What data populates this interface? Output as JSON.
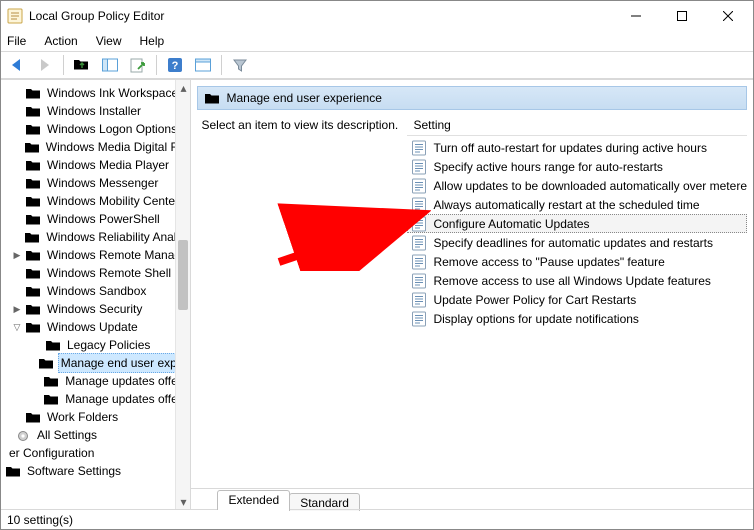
{
  "title": "Local Group Policy Editor",
  "menubar": [
    "File",
    "Action",
    "View",
    "Help"
  ],
  "toolbar_icons": [
    "back-icon",
    "forward-icon",
    "up-icon",
    "tree-icon",
    "refresh-icon",
    "help-icon",
    "filter-view-icon",
    "filter-icon"
  ],
  "tree": {
    "items": [
      {
        "label": "Windows Ink Workspace",
        "indent": 2
      },
      {
        "label": "Windows Installer",
        "indent": 2
      },
      {
        "label": "Windows Logon Options",
        "indent": 2
      },
      {
        "label": "Windows Media Digital Rig",
        "indent": 2
      },
      {
        "label": "Windows Media Player",
        "indent": 2
      },
      {
        "label": "Windows Messenger",
        "indent": 2
      },
      {
        "label": "Windows Mobility Center",
        "indent": 2
      },
      {
        "label": "Windows PowerShell",
        "indent": 2
      },
      {
        "label": "Windows Reliability Analys",
        "indent": 2
      },
      {
        "label": "Windows Remote Manage",
        "indent": 2,
        "toggle": ">"
      },
      {
        "label": "Windows Remote Shell",
        "indent": 2
      },
      {
        "label": "Windows Sandbox",
        "indent": 2
      },
      {
        "label": "Windows Security",
        "indent": 2,
        "toggle": ">"
      },
      {
        "label": "Windows Update",
        "indent": 2,
        "toggle": "v"
      },
      {
        "label": "Legacy Policies",
        "indent": 3
      },
      {
        "label": "Manage end user exper",
        "indent": 3,
        "selected": true
      },
      {
        "label": "Manage updates offere",
        "indent": 3
      },
      {
        "label": "Manage updates offere",
        "indent": 3
      },
      {
        "label": "Work Folders",
        "indent": 2
      }
    ],
    "tail": [
      {
        "label": "All Settings"
      },
      {
        "label": "er Configuration"
      },
      {
        "label": "Software Settings"
      }
    ]
  },
  "content": {
    "header": "Manage end user experience",
    "description_prompt": "Select an item to view its description.",
    "column_header": "Setting",
    "settings": [
      "Turn off auto-restart for updates during active hours",
      "Specify active hours range for auto-restarts",
      "Allow updates to be downloaded automatically over metere",
      "Always automatically restart at the scheduled time",
      "Configure Automatic Updates",
      "Specify deadlines for automatic updates and restarts",
      "Remove access to \"Pause updates\" feature",
      "Remove access to use all Windows Update features",
      "Update Power Policy for Cart Restarts",
      "Display options for update notifications"
    ],
    "selected_index": 4
  },
  "tabs": {
    "extended": "Extended",
    "standard": "Standard"
  },
  "status": "10 setting(s)"
}
